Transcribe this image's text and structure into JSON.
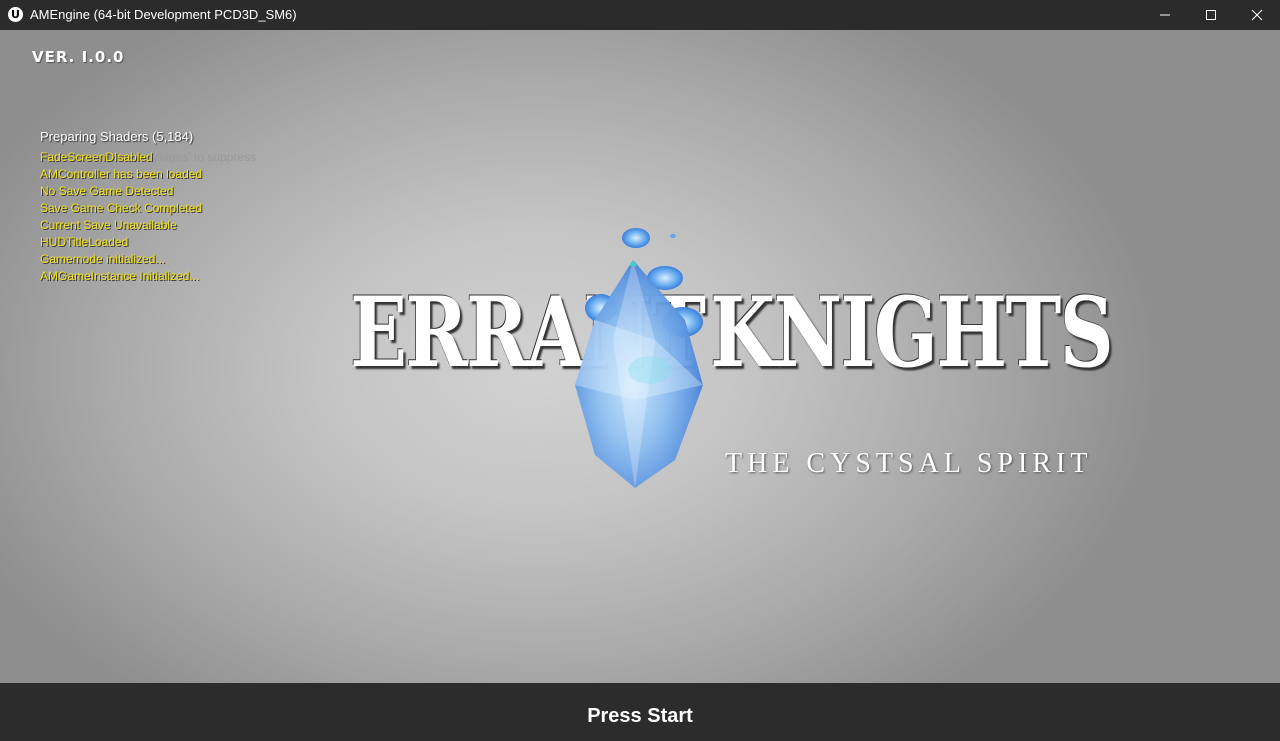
{
  "window": {
    "title": "AMEngine (64-bit Development PCD3D_SM6)",
    "app_icon": "unreal-engine-logo-icon"
  },
  "hud": {
    "version": "VER. I.0.0",
    "shader_message": "Preparing Shaders (5,184)",
    "suppress_hint": "'DisableAllScreenMessages' to suppress",
    "debug_messages": [
      "FadeScreenDIsabled",
      "AMController has been loaded",
      "No Save Game Detected",
      "Save Game Check Completed",
      "Current Save Unavailable",
      "HUDTitleLoaded",
      "Gamemode initialized...",
      "AMGameInstance Initialized..."
    ]
  },
  "logo": {
    "word1": "ERRANT",
    "word2": "KNIGHTS",
    "subtitle": "THE CYSTSAL SPIRIT"
  },
  "footer": {
    "prompt": "Press Start"
  },
  "colors": {
    "titlebar": "#2b2b2b",
    "debug_text": "#f2e21c",
    "footer_bg": "#2c2c2c"
  }
}
